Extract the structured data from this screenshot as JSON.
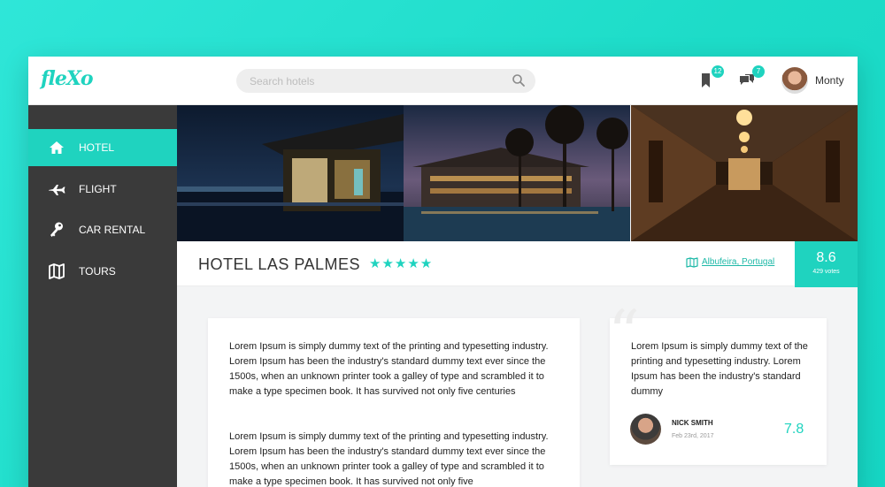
{
  "app": {
    "logo": "fleXo"
  },
  "search": {
    "placeholder": "Search hotels"
  },
  "header": {
    "bookmarks_count": "12",
    "messages_count": "7",
    "user_name": "Monty"
  },
  "sidebar": {
    "items": [
      {
        "label": "HOTEL",
        "icon": "home-icon",
        "active": true
      },
      {
        "label": "FLIGHT",
        "icon": "plane-icon",
        "active": false
      },
      {
        "label": "CAR RENTAL",
        "icon": "key-icon",
        "active": false
      },
      {
        "label": "TOURS",
        "icon": "map-icon",
        "active": false
      }
    ]
  },
  "hotel": {
    "name": "HOTEL LAS PALMES",
    "stars": "★★★★★",
    "star_rating": 5,
    "location": "Albufeira, Portugal",
    "score": "8.6",
    "votes": "429 votes"
  },
  "description": {
    "paragraphs": [
      "Lorem Ipsum is simply dummy text of the printing and typesetting industry. Lorem Ipsum has been the industry's standard dummy text ever since the 1500s, when an unknown printer took a galley of type and scrambled it to make a type specimen book. It has survived not only five centuries",
      "Lorem Ipsum is simply dummy text of the printing and typesetting industry. Lorem Ipsum has been the industry's standard dummy text ever since the 1500s, when an unknown printer took a galley of type and scrambled it to make a type specimen book. It has survived not only five"
    ]
  },
  "review": {
    "text": "Lorem Ipsum is simply dummy text of the printing and typesetting industry. Lorem Ipsum has been the industry's standard dummy",
    "reviewer": "NICK SMITH",
    "date": "Feb 23rd, 2017",
    "score": "7.8"
  },
  "colors": {
    "accent": "#1fd3bf",
    "sidebar": "#3a3a3a",
    "background": "#2fe6d8"
  }
}
